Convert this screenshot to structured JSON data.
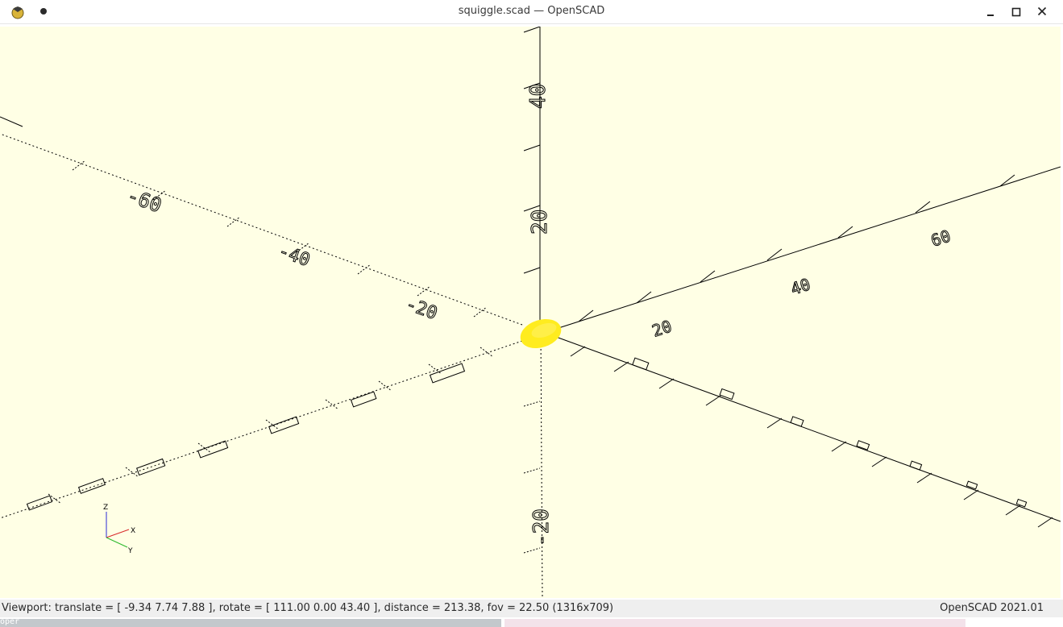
{
  "window": {
    "title": "squiggle.scad — OpenSCAD",
    "icons": {
      "app": "openscad-logo-icon",
      "pin": "dot-icon",
      "minimize": "minimize-icon",
      "maximize": "maximize-icon",
      "close": "close-icon"
    }
  },
  "viewport": {
    "background_color": "#ffffe5",
    "object_color": "#ffec1f",
    "axis_labels": {
      "z_pos_40": "40",
      "z_pos_20": "20",
      "z_neg_20": "-20",
      "x_pos_20": "20",
      "x_pos_40": "40",
      "x_pos_60": "60",
      "x_neg_20": "-20",
      "x_neg_40": "-40",
      "x_neg_60": "-60"
    },
    "axes_indicator": {
      "x": "X",
      "y": "Y",
      "z": "Z"
    }
  },
  "statusbar": {
    "viewport_info": "Viewport: translate = [ -9.34 7.74 7.88 ], rotate = [ 111.00 0.00 43.40 ], distance = 213.38, fov = 22.50 (1316x709)",
    "version": "OpenSCAD 2021.01"
  },
  "taskbar_peek": {
    "left_text": "oper"
  }
}
